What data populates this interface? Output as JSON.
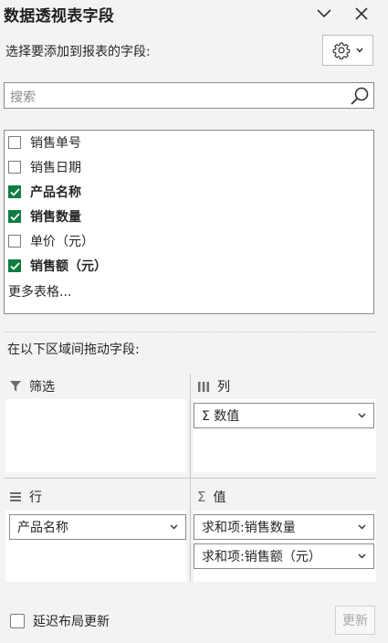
{
  "header": {
    "title": "数据透视表字段",
    "collapse_icon": "chevron-down-icon",
    "close_icon": "close-icon"
  },
  "field_chooser": {
    "label": "选择要添加到报表的字段:",
    "settings_icon": "gear-icon",
    "search": {
      "placeholder": "搜索",
      "value": ""
    },
    "fields": [
      {
        "label": "销售单号",
        "checked": false
      },
      {
        "label": "销售日期",
        "checked": false
      },
      {
        "label": "产品名称",
        "checked": true
      },
      {
        "label": "销售数量",
        "checked": true
      },
      {
        "label": "单价（元）",
        "checked": false
      },
      {
        "label": "销售额（元）",
        "checked": true
      }
    ],
    "more_tables": "更多表格..."
  },
  "areas": {
    "drag_label": "在以下区域间拖动字段:",
    "filters": {
      "label": "筛选",
      "items": []
    },
    "columns": {
      "label": "列",
      "items": [
        "Σ 数值"
      ]
    },
    "rows": {
      "label": "行",
      "items": [
        "产品名称"
      ]
    },
    "values": {
      "label": "值",
      "items": [
        "求和项:销售数量",
        "求和项:销售额（元）"
      ]
    }
  },
  "footer": {
    "defer_label": "延迟布局更新",
    "defer_checked": false,
    "update_label": "更新"
  },
  "colors": {
    "accent": "#107c41",
    "panel": "#f3f3f3",
    "border": "#8a8a8a"
  }
}
